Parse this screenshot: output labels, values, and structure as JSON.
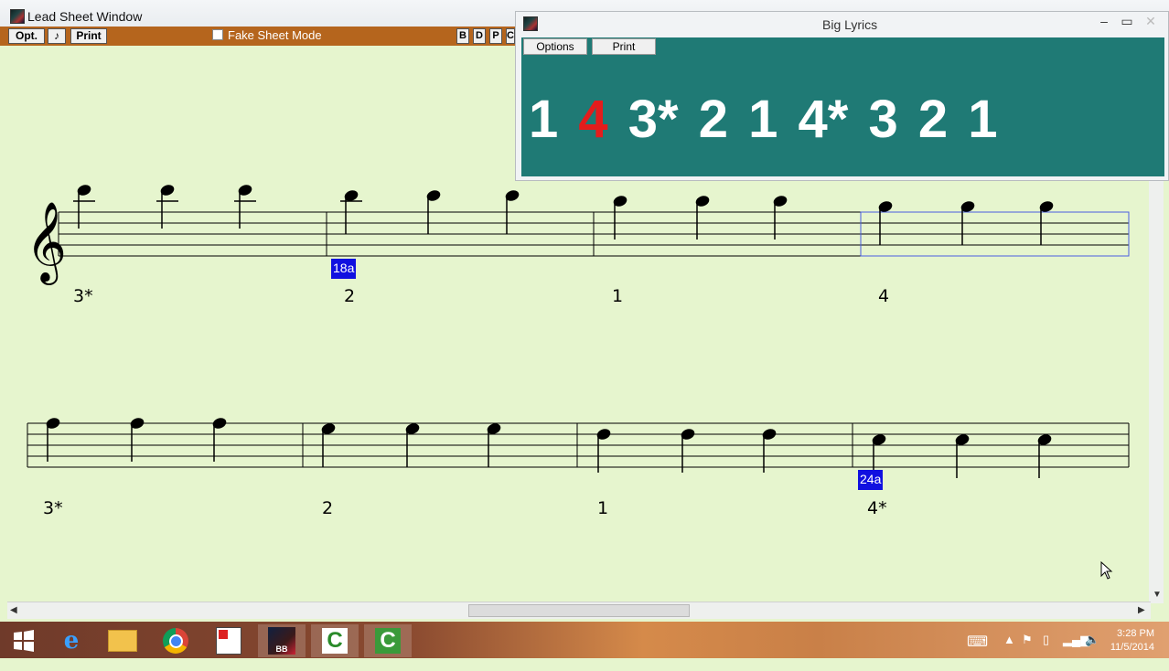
{
  "lead_sheet": {
    "title": "Lead Sheet Window",
    "toolbar": {
      "opt": "Opt.",
      "note": "♪",
      "print": "Print",
      "fake_sheet": "Fake Sheet Mode",
      "b": "B",
      "d": "D",
      "p": "P",
      "c": "C"
    }
  },
  "big_lyrics": {
    "title": "Big Lyrics",
    "options": "Options",
    "print": "Print",
    "tokens": [
      "1",
      "4",
      "3*",
      "2",
      "1",
      "4*",
      "3",
      "2",
      "1"
    ],
    "highlight_index": 1,
    "highlight_color": "#e41c1c",
    "bg_color": "#1f7a75"
  },
  "staff": {
    "row1": {
      "counts": [
        "3*",
        "2",
        "1",
        "4"
      ],
      "marker": "18a"
    },
    "row2": {
      "counts": [
        "3*",
        "2",
        "1",
        "4*"
      ],
      "marker": "24a"
    }
  },
  "taskbar": {
    "time": "3:28 PM",
    "date": "11/5/2014",
    "apps": [
      "start-icon",
      "internet-explorer-icon",
      "file-explorer-icon",
      "chrome-icon",
      "app-icon",
      "band-in-a-box-icon",
      "camtasia-icon",
      "camtasia-recorder-icon"
    ],
    "bb_label": "BB"
  }
}
